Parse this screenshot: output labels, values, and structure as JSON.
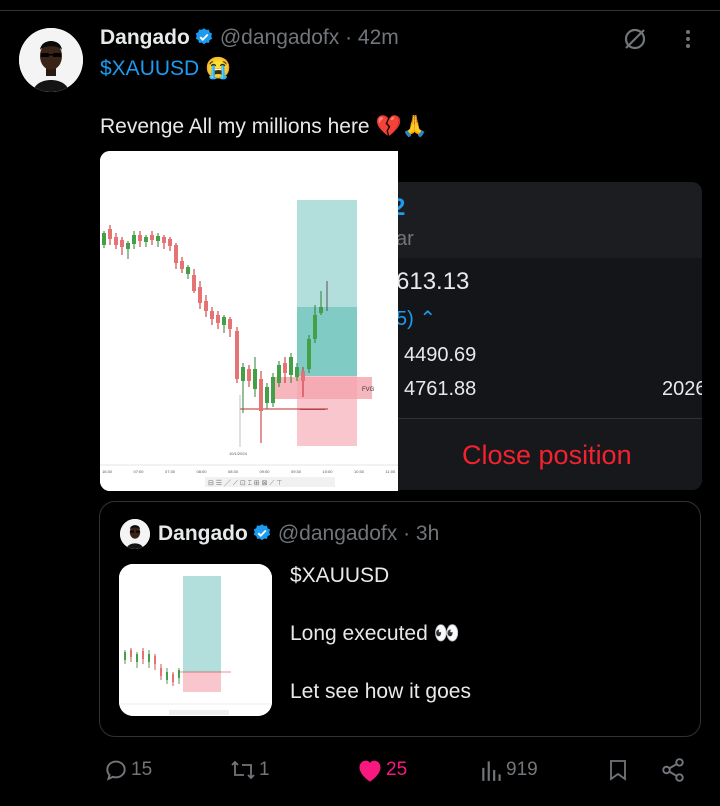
{
  "post": {
    "author_name": "Dangado",
    "handle": "@dangadofx",
    "time": "· 42m",
    "cashtag": "$XAUUSD 😭",
    "text": "Revenge All my millions here 💔🙏"
  },
  "position_card": {
    "title_fragment": "2",
    "subtitle_fragment": "ar",
    "value": "613.13",
    "change_fragment": "5)",
    "price_1": "4490.69",
    "price_2": "4761.88",
    "year_fragment": "2026",
    "close_label": "Close position"
  },
  "chart_image": {
    "fvg_label": "FVG",
    "date_label": "10/1/2024",
    "time_ticks": [
      "16:30",
      "07:00",
      "07:30",
      "08:00",
      "08:30",
      "09:00",
      "09:30",
      "10:00",
      "10:30",
      "11:00"
    ]
  },
  "quote": {
    "author_name": "Dangado",
    "handle": "@dangadofx",
    "time": "· 3h",
    "line1": "$XAUUSD",
    "line2": "Long executed 👀",
    "line3": "Let see how it goes"
  },
  "actions": {
    "replies": "15",
    "reposts": "1",
    "likes": "25",
    "views": "919"
  },
  "colors": {
    "accent": "#1d9bf0",
    "like": "#f91880",
    "close_red": "#f4212e",
    "muted": "#71767b"
  }
}
